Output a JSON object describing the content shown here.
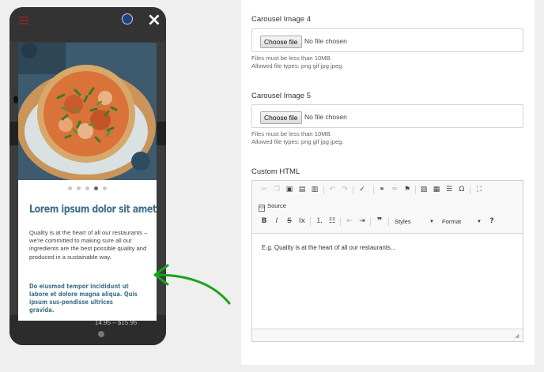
{
  "phone": {
    "close_icon": "×",
    "carousel": {
      "dots": 5,
      "active_index": 3
    },
    "title": "Lorem ipsum dolor sit amet",
    "body": "Quality is at the heart of all our restaurants – we're committed to making sure all our ingredients are the best possible quality and produced in a sustainable way.",
    "highlight": "Do eiusmod tempor incididunt ut labore et dolore magna aliqua. Quis ipsum sus-pendisse ultrices gravida.",
    "behind_price": "14.95 – $15.95"
  },
  "colors": {
    "accent": "#3e6f87",
    "arrow": "#1aa31a",
    "phone": "#3b3b3b"
  },
  "form": {
    "carousel4": {
      "label": "Carousel Image 4",
      "button": "Choose file",
      "status": "No file chosen",
      "help1": "Files must be less than 10MB.",
      "help2": "Allowed file types: png gif jpg jpeg."
    },
    "carousel5": {
      "label": "Carousel Image 5",
      "button": "Choose file",
      "status": "No file chosen",
      "help1": "Files must be less than 10MB.",
      "help2": "Allowed file types: png gif jpg jpeg."
    },
    "custom_html": {
      "label": "Custom HTML",
      "source": "Source",
      "styles": "Styles",
      "format": "Format",
      "placeholder": "E.g. Quality is at the heart of all our restaurants..."
    }
  }
}
